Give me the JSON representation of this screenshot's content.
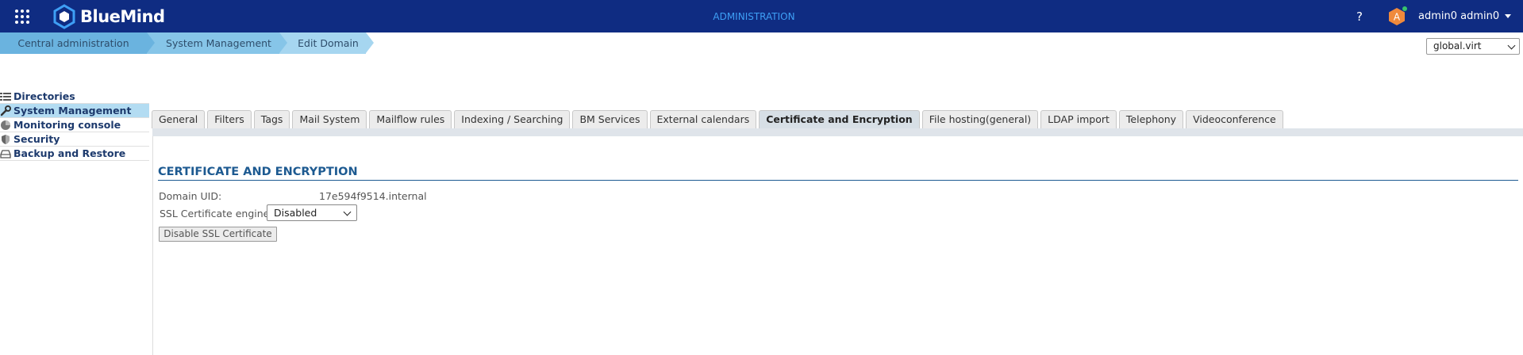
{
  "header": {
    "logo_text": "BlueMind",
    "title": "ADMINISTRATION",
    "help": "?",
    "avatar_initial": "A",
    "username": "admin0 admin0",
    "apps_icon": "apps-grid-icon"
  },
  "breadcrumb": [
    "Central administration",
    "System Management",
    "Edit Domain"
  ],
  "domain_select": {
    "value": "global.virt"
  },
  "sidebar": {
    "items": [
      {
        "label": "Directories",
        "icon": "list-icon"
      },
      {
        "label": "System Management",
        "icon": "wrench-icon",
        "active": true
      },
      {
        "label": "Monitoring console",
        "icon": "pie-chart-icon"
      },
      {
        "label": "Security",
        "icon": "shield-icon"
      },
      {
        "label": "Backup and Restore",
        "icon": "drive-icon"
      }
    ]
  },
  "tabs": [
    "General",
    "Filters",
    "Tags",
    "Mail System",
    "Mailflow rules",
    "Indexing / Searching",
    "BM Services",
    "External calendars",
    "Certificate and Encryption",
    "File hosting(general)",
    "LDAP import",
    "Telephony",
    "Videoconference"
  ],
  "active_tab": "Certificate and Encryption",
  "content": {
    "section_title": "CERTIFICATE AND ENCRYPTION",
    "domain_uid_label": "Domain UID:",
    "domain_uid_value": "17e594f9514.internal",
    "ssl_engine_label": "SSL Certificate engine",
    "ssl_engine_value": "Disabled",
    "disable_button": "Disable SSL Certificate"
  },
  "colors": {
    "topbar": "#0f2c82",
    "title_accent": "#3e9ff5",
    "section_title": "#1d5a91",
    "active_sidebar": "#b3dcf2"
  }
}
